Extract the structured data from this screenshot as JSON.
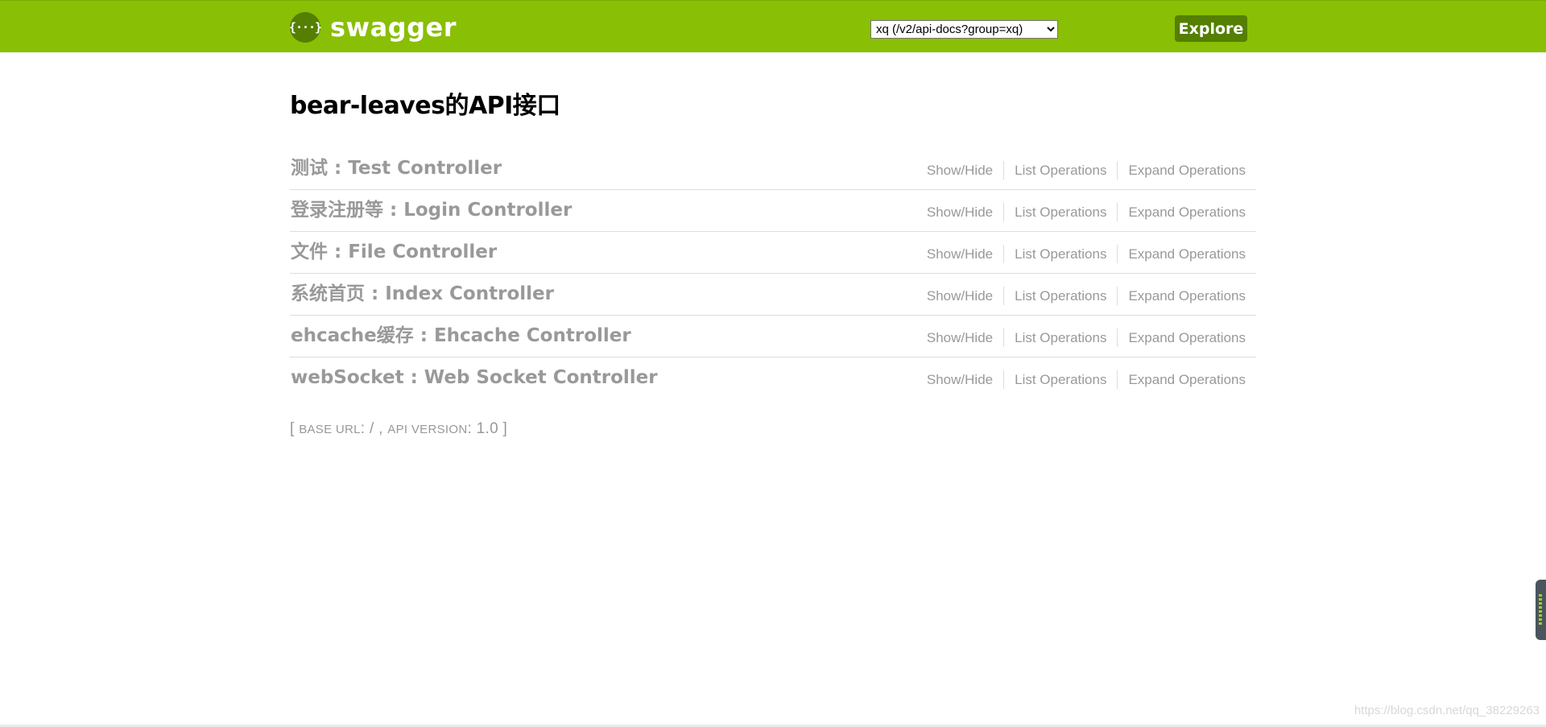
{
  "header": {
    "logo_glyph": "{···}",
    "brand": "swagger",
    "select_value": "xq (/v2/api-docs?group=xq)",
    "explore_label": "Explore",
    "colors": {
      "bar": "#89bf04",
      "button": "#547f00"
    }
  },
  "main": {
    "title": "bear-leaves的API接口",
    "resources": [
      {
        "name": "测试 : Test Controller",
        "show_hide": "Show/Hide",
        "list_ops": "List Operations",
        "expand_ops": "Expand Operations"
      },
      {
        "name": "登录注册等 : Login Controller",
        "show_hide": "Show/Hide",
        "list_ops": "List Operations",
        "expand_ops": "Expand Operations"
      },
      {
        "name": "文件 : File Controller",
        "show_hide": "Show/Hide",
        "list_ops": "List Operations",
        "expand_ops": "Expand Operations"
      },
      {
        "name": "系统首页 : Index Controller",
        "show_hide": "Show/Hide",
        "list_ops": "List Operations",
        "expand_ops": "Expand Operations"
      },
      {
        "name": "ehcache缓存 : Ehcache Controller",
        "show_hide": "Show/Hide",
        "list_ops": "List Operations",
        "expand_ops": "Expand Operations"
      },
      {
        "name": "webSocket : Web Socket Controller",
        "show_hide": "Show/Hide",
        "list_ops": "List Operations",
        "expand_ops": "Expand Operations"
      }
    ],
    "footer": {
      "open": "[",
      "base_url_label": "base url",
      "base_url_value": ": / ,",
      "api_version_label": "api version",
      "api_version_value": ": 1.0",
      "close": "]"
    }
  },
  "watermark": "https://blog.csdn.net/qq_38229263"
}
